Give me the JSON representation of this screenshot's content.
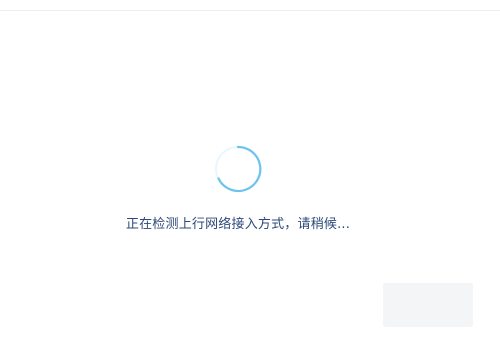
{
  "loading": {
    "status_text": "正在检测上行网络接入方式，请稍候...",
    "spinner_icon": "loading-spinner-icon",
    "spinner_color": "#6cc4ee"
  },
  "colors": {
    "background": "#ffffff",
    "text": "#2c4a78",
    "divider": "#eeeeee",
    "faded_button": "#f4f5f7"
  }
}
